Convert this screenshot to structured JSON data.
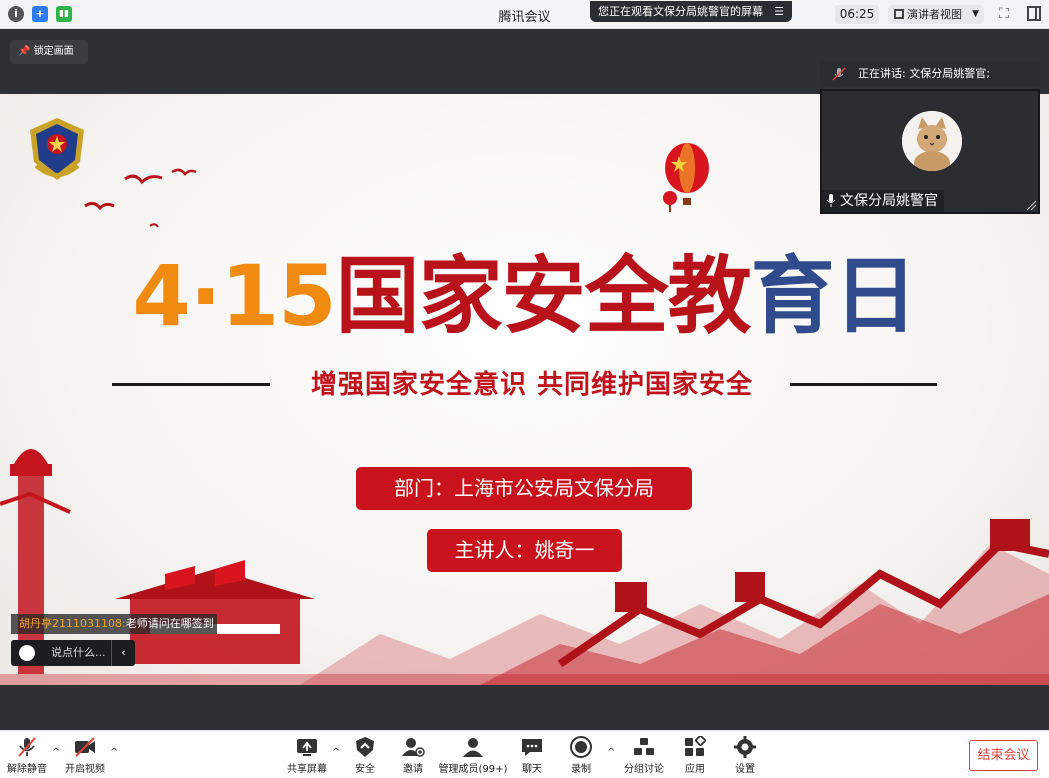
{
  "window": {
    "title": "腾讯会议",
    "watching_notice": "您正在观看文保分局姚警官的屏幕",
    "timer": "06:25",
    "view_mode": "演讲者视图"
  },
  "stage": {
    "lock_label": "锁定画面",
    "speaking_label": "正在讲话: 文保分局姚警官;",
    "participant_name": "文保分局姚警官"
  },
  "slide": {
    "title_number": "4·15",
    "title_text_a": "国家安全教",
    "title_text_b": "育日",
    "subtitle": "增强国家安全意识  共同维护国家安全",
    "department": "部门：上海市公安局文保分局",
    "speaker": "主讲人：姚奇一"
  },
  "chat": {
    "sender": "胡丹亭2111031108:",
    "message": "老师请问在哪签到",
    "input_placeholder": "说点什么..."
  },
  "toolbar": {
    "unmute": "解除静音",
    "start_video": "开启视频",
    "share_screen": "共享屏幕",
    "security": "安全",
    "invite": "邀请",
    "manage_members": "管理成员(99+)",
    "chat": "聊天",
    "record": "录制",
    "breakout": "分组讨论",
    "apps": "应用",
    "settings": "设置",
    "end_meeting": "结束会议"
  },
  "colors": {
    "brand_red": "#c8121c",
    "end_red": "#e0433b",
    "dark_stage": "#2f3033"
  }
}
